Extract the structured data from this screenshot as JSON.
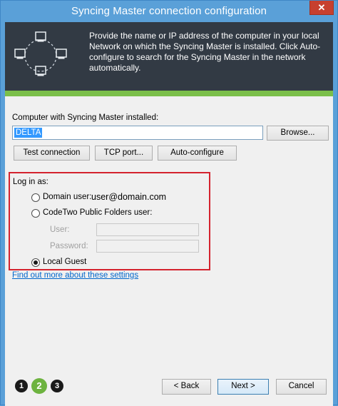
{
  "window": {
    "title": "Syncing Master connection configuration",
    "close_label": "✕"
  },
  "banner": {
    "description": "Provide the name or IP address of the computer in your local Network on which the Syncing Master is installed. Click Auto-configure to search for the Syncing Master in the network automatically.",
    "icon": "network-computers-icon"
  },
  "computer": {
    "label": "Computer with Syncing Master installed:",
    "value": "DELTA",
    "browse_label": "Browse..."
  },
  "actions": {
    "test_label": "Test connection",
    "tcp_label": "TCP port...",
    "auto_label": "Auto-configure"
  },
  "login": {
    "heading": "Log in as:",
    "domain_user_label": "Domain user:",
    "domain_user_value": "user@domain.com",
    "public_folders_label": "CodeTwo Public Folders user:",
    "user_label": "User:",
    "password_label": "Password:",
    "local_guest_label": "Local Guest",
    "selected": "local_guest"
  },
  "link_text": "Find out more about these settings",
  "wizard": {
    "steps": [
      "1",
      "2",
      "3"
    ],
    "current_step": 2
  },
  "buttons": {
    "back_label": "< Back",
    "next_label": "Next >",
    "cancel_label": "Cancel"
  },
  "colors": {
    "accent_border": "#d4232e",
    "banner_bg": "#323a44",
    "green_bar": "#7bbf4a",
    "active_step": "#6db33f"
  }
}
